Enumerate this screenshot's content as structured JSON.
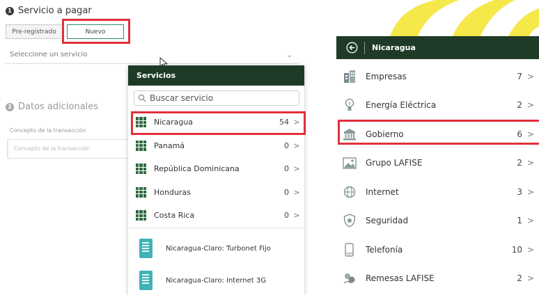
{
  "form": {
    "step1_number": "1",
    "step1_title": "Servicio a pagar",
    "tab_preregistrado": "Pre-registrado",
    "tab_nuevo": "Nuevo",
    "select_placeholder": "Seleccione un servicio",
    "select_chevron": "⌄",
    "step2_number": "2",
    "step2_title": "Datos adicionales",
    "concept_label": "Concepto de la transacción",
    "concept_placeholder": "Concepto de la transacción"
  },
  "dropdown": {
    "header": "Servicios",
    "search_placeholder": "Buscar servicio",
    "countries": [
      {
        "name": "Nicaragua",
        "count": "54",
        "chevron": ">"
      },
      {
        "name": "Panamá",
        "count": "0",
        "chevron": ">"
      },
      {
        "name": "República Dominicana",
        "count": "0",
        "chevron": ">"
      },
      {
        "name": "Honduras",
        "count": "0",
        "chevron": ">"
      },
      {
        "name": "Costa Rica",
        "count": "0",
        "chevron": ">"
      }
    ],
    "services": [
      {
        "name": "Nicaragua-Claro: Turbonet Fijo"
      },
      {
        "name": "Nicaragua-Claro: Internet 3G"
      }
    ]
  },
  "panel": {
    "title": "Nicaragua",
    "categories": [
      {
        "name": "Empresas",
        "count": "7",
        "chevron": ">",
        "icon": "buildings-icon"
      },
      {
        "name": "Energía Eléctrica",
        "count": "2",
        "chevron": ">",
        "icon": "lightbulb-icon"
      },
      {
        "name": "Gobierno",
        "count": "6",
        "chevron": ">",
        "icon": "government-building-icon"
      },
      {
        "name": "Grupo LAFISE",
        "count": "2",
        "chevron": ">",
        "icon": "image-icon"
      },
      {
        "name": "Internet",
        "count": "3",
        "chevron": ">",
        "icon": "globe-icon"
      },
      {
        "name": "Seguridad",
        "count": "1",
        "chevron": ">",
        "icon": "shield-icon"
      },
      {
        "name": "Telefonía",
        "count": "10",
        "chevron": ">",
        "icon": "phone-icon"
      },
      {
        "name": "Remesas LAFISE",
        "count": "2",
        "chevron": ">",
        "icon": "money-transfer-icon"
      }
    ]
  },
  "colors": {
    "header_green": "#1d3b27",
    "grid_icon_green": "#2d6a3e",
    "highlight_red": "#e0303c",
    "service_icon_teal": "#3fb3b6",
    "background_accent_yellow": "#f5e84a"
  }
}
